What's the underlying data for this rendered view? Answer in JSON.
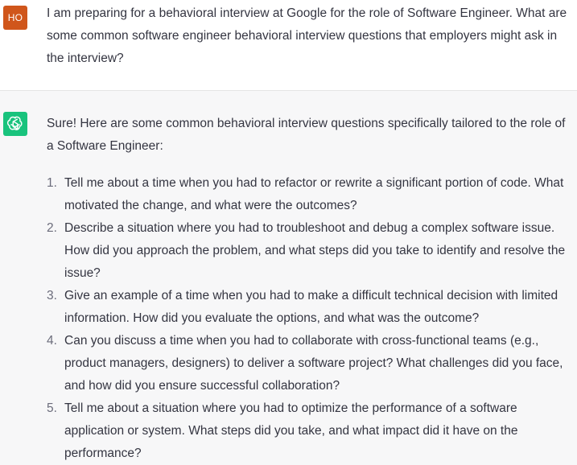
{
  "user": {
    "initials": "HO",
    "message": "I am preparing for a behavioral interview at Google for the role of Software Engineer. What are some common software engineer behavioral interview questions that employers might ask in the interview?"
  },
  "assistant": {
    "icon": "openai-logo-icon",
    "intro": "Sure! Here are some common behavioral interview questions specifically tailored to the role of a Software Engineer:",
    "items": [
      {
        "num": "1.",
        "text": "Tell me about a time when you had to refactor or rewrite a significant portion of code. What motivated the change, and what were the outcomes?"
      },
      {
        "num": "2.",
        "text": "Describe a situation where you had to troubleshoot and debug a complex software issue. How did you approach the problem, and what steps did you take to identify and resolve the issue?"
      },
      {
        "num": "3.",
        "text": "Give an example of a time when you had to make a difficult technical decision with limited information. How did you evaluate the options, and what was the outcome?"
      },
      {
        "num": "4.",
        "text": "Can you discuss a time when you had to collaborate with cross-functional teams (e.g., product managers, designers) to deliver a software project? What challenges did you face, and how did you ensure successful collaboration?"
      },
      {
        "num": "5.",
        "text": "Tell me about a situation where you had to optimize the performance of a software application or system. What steps did you take, and what impact did it have on the performance?"
      }
    ]
  },
  "colors": {
    "user_avatar": "#d0561b",
    "bot_avatar": "#19c37d",
    "assistant_bg": "#f7f7f8"
  }
}
